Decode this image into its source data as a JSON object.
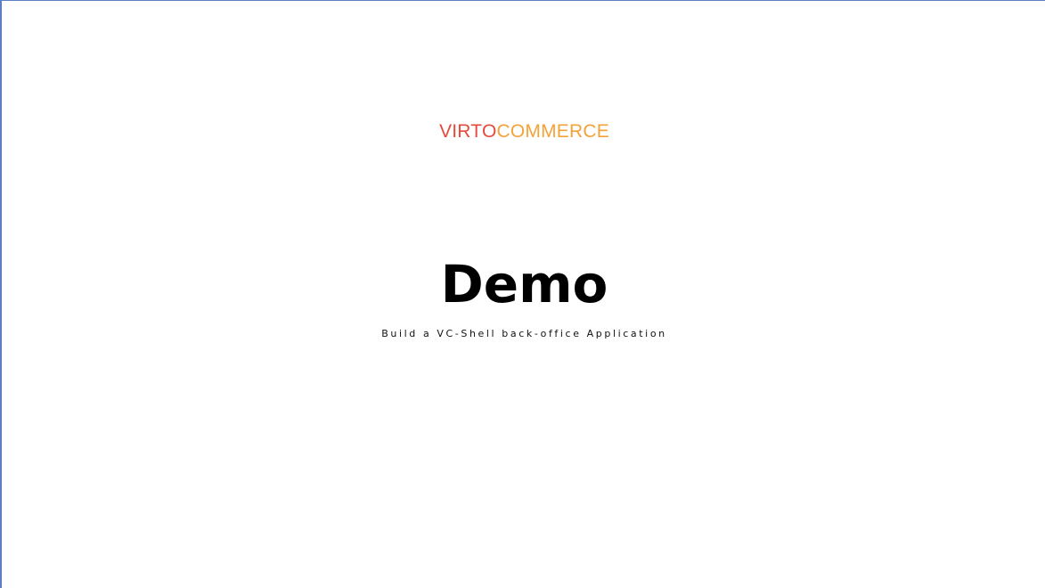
{
  "slide": {
    "logo": {
      "part_a": "VIRTO",
      "part_b": "COMMERCE",
      "colors": {
        "part_a": "#e64a3c",
        "part_b": "#f4a23a"
      }
    },
    "title": "Demo",
    "subtitle": "Build a VC-Shell back-office Application"
  }
}
